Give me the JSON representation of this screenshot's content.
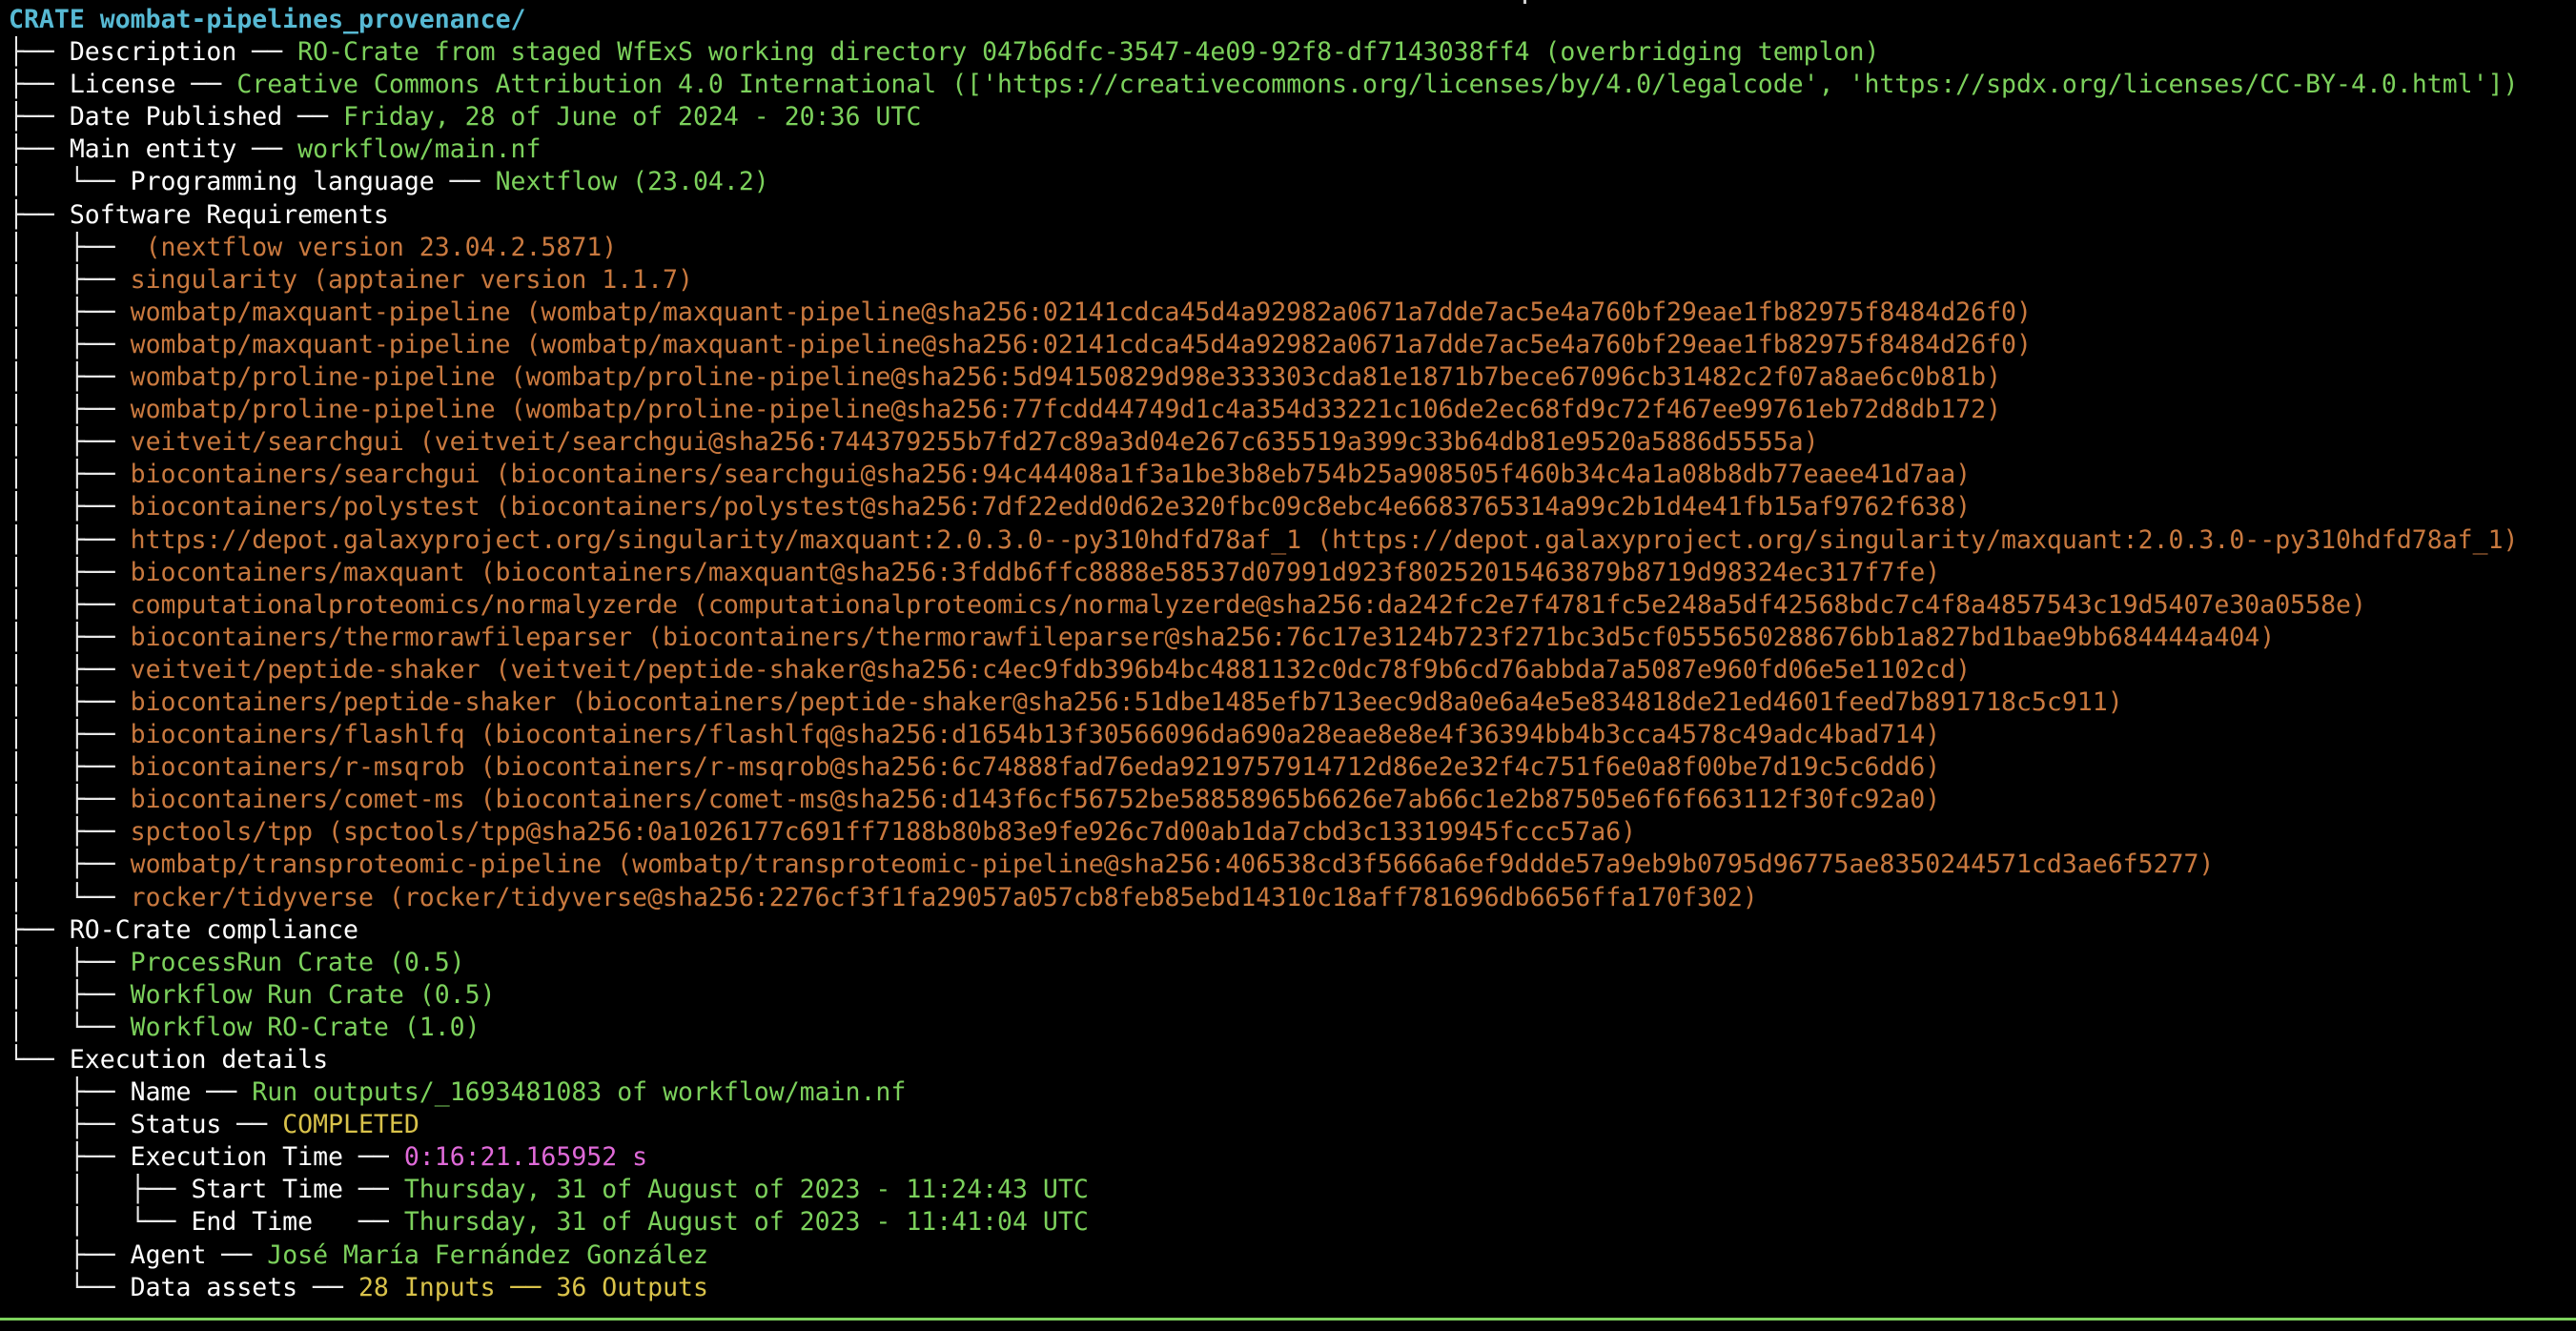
{
  "crate": {
    "prefix": "CRATE",
    "name": "wombat-pipelines_provenance/"
  },
  "fields": {
    "description": {
      "label": "Description",
      "value": "RO-Crate from staged WfExS working directory 047b6dfc-3547-4e09-92f8-df7143038ff4 (overbridging templon)"
    },
    "license": {
      "label": "License",
      "value": "Creative Commons Attribution 4.0 International (['https://creativecommons.org/licenses/by/4.0/legalcode', 'https://spdx.org/licenses/CC-BY-4.0.html'])"
    },
    "date_published": {
      "label": "Date Published",
      "value": "Friday, 28 of June of 2024 - 20:36 UTC"
    },
    "main_entity": {
      "label": "Main entity",
      "value": "workflow/main.nf",
      "programming_language": {
        "label": "Programming language",
        "value": "Nextflow (23.04.2)"
      }
    }
  },
  "software_requirements": {
    "label": "Software Requirements",
    "items": [
      " (nextflow version 23.04.2.5871)",
      "singularity (apptainer version 1.1.7)",
      "wombatp/maxquant-pipeline (wombatp/maxquant-pipeline@sha256:02141cdca45d4a92982a0671a7dde7ac5e4a760bf29eae1fb82975f8484d26f0)",
      "wombatp/maxquant-pipeline (wombatp/maxquant-pipeline@sha256:02141cdca45d4a92982a0671a7dde7ac5e4a760bf29eae1fb82975f8484d26f0)",
      "wombatp/proline-pipeline (wombatp/proline-pipeline@sha256:5d94150829d98e333303cda81e1871b7bece67096cb31482c2f07a8ae6c0b81b)",
      "wombatp/proline-pipeline (wombatp/proline-pipeline@sha256:77fcdd44749d1c4a354d33221c106de2ec68fd9c72f467ee99761eb72d8db172)",
      "veitveit/searchgui (veitveit/searchgui@sha256:744379255b7fd27c89a3d04e267c635519a399c33b64db81e9520a5886d5555a)",
      "biocontainers/searchgui (biocontainers/searchgui@sha256:94c44408a1f3a1be3b8eb754b25a908505f460b34c4a1a08b8db77eaee41d7aa)",
      "biocontainers/polystest (biocontainers/polystest@sha256:7df22edd0d62e320fbc09c8ebc4e6683765314a99c2b1d4e41fb15af9762f638)",
      "https://depot.galaxyproject.org/singularity/maxquant:2.0.3.0--py310hdfd78af_1 (https://depot.galaxyproject.org/singularity/maxquant:2.0.3.0--py310hdfd78af_1)",
      "biocontainers/maxquant (biocontainers/maxquant@sha256:3fddb6ffc8888e58537d07991d923f80252015463879b8719d98324ec317f7fe)",
      "computationalproteomics/normalyzerde (computationalproteomics/normalyzerde@sha256:da242fc2e7f4781fc5e248a5df42568bdc7c4f8a4857543c19d5407e30a0558e)",
      "biocontainers/thermorawfileparser (biocontainers/thermorawfileparser@sha256:76c17e3124b723f271bc3d5cf0555650288676bb1a827bd1bae9bb684444a404)",
      "veitveit/peptide-shaker (veitveit/peptide-shaker@sha256:c4ec9fdb396b4bc4881132c0dc78f9b6cd76abbda7a5087e960fd06e5e1102cd)",
      "biocontainers/peptide-shaker (biocontainers/peptide-shaker@sha256:51dbe1485efb713eec9d8a0e6a4e5e834818de21ed4601feed7b891718c5c911)",
      "biocontainers/flashlfq (biocontainers/flashlfq@sha256:d1654b13f30566096da690a28eae8e8e4f36394bb4b3cca4578c49adc4bad714)",
      "biocontainers/r-msqrob (biocontainers/r-msqrob@sha256:6c74888fad76eda9219757914712d86e2e32f4c751f6e0a8f00be7d19c5c6dd6)",
      "biocontainers/comet-ms (biocontainers/comet-ms@sha256:d143f6cf56752be58858965b6626e7ab66c1e2b87505e6f6f663112f30fc92a0)",
      "spctools/tpp (spctools/tpp@sha256:0a1026177c691ff7188b80b83e9fe926c7d00ab1da7cbd3c13319945fccc57a6)",
      "wombatp/transproteomic-pipeline (wombatp/transproteomic-pipeline@sha256:406538cd3f5666a6ef9ddde57a9eb9b0795d96775ae8350244571cd3ae6f5277)",
      "rocker/tidyverse (rocker/tidyverse@sha256:2276cf3f1fa29057a057cb8feb85ebd14310c18aff781696db6656ffa170f302)"
    ]
  },
  "compliance": {
    "label": "RO-Crate compliance",
    "items": [
      "ProcessRun Crate (0.5)",
      "Workflow Run Crate (0.5)",
      "Workflow RO-Crate (1.0)"
    ]
  },
  "execution": {
    "label": "Execution details",
    "name": {
      "label": "Name",
      "value": "Run outputs/_1693481083 of workflow/main.nf"
    },
    "status": {
      "label": "Status",
      "value": "COMPLETED"
    },
    "execution_time": {
      "label": "Execution Time",
      "value": "0:16:21.165952 s"
    },
    "start_time": {
      "label": "Start Time",
      "value": "Thursday, 31 of August of 2023 - 11:24:43 UTC"
    },
    "end_time": {
      "label": "End Time  ",
      "value": "Thursday, 31 of August of 2023 - 11:41:04 UTC"
    },
    "agent": {
      "label": "Agent",
      "value": "José María Fernández González"
    },
    "data_assets": {
      "label": "Data assets",
      "inputs": "28 Inputs",
      "separator": "──",
      "outputs": "36 Outputs"
    }
  },
  "colors": {
    "background": "#000000",
    "root": "#57b9d3",
    "value_green": "#7cd15c",
    "requirement_orange": "#c9793f",
    "status_yellow": "#d9c24a",
    "time_magenta": "#e06ad9"
  }
}
